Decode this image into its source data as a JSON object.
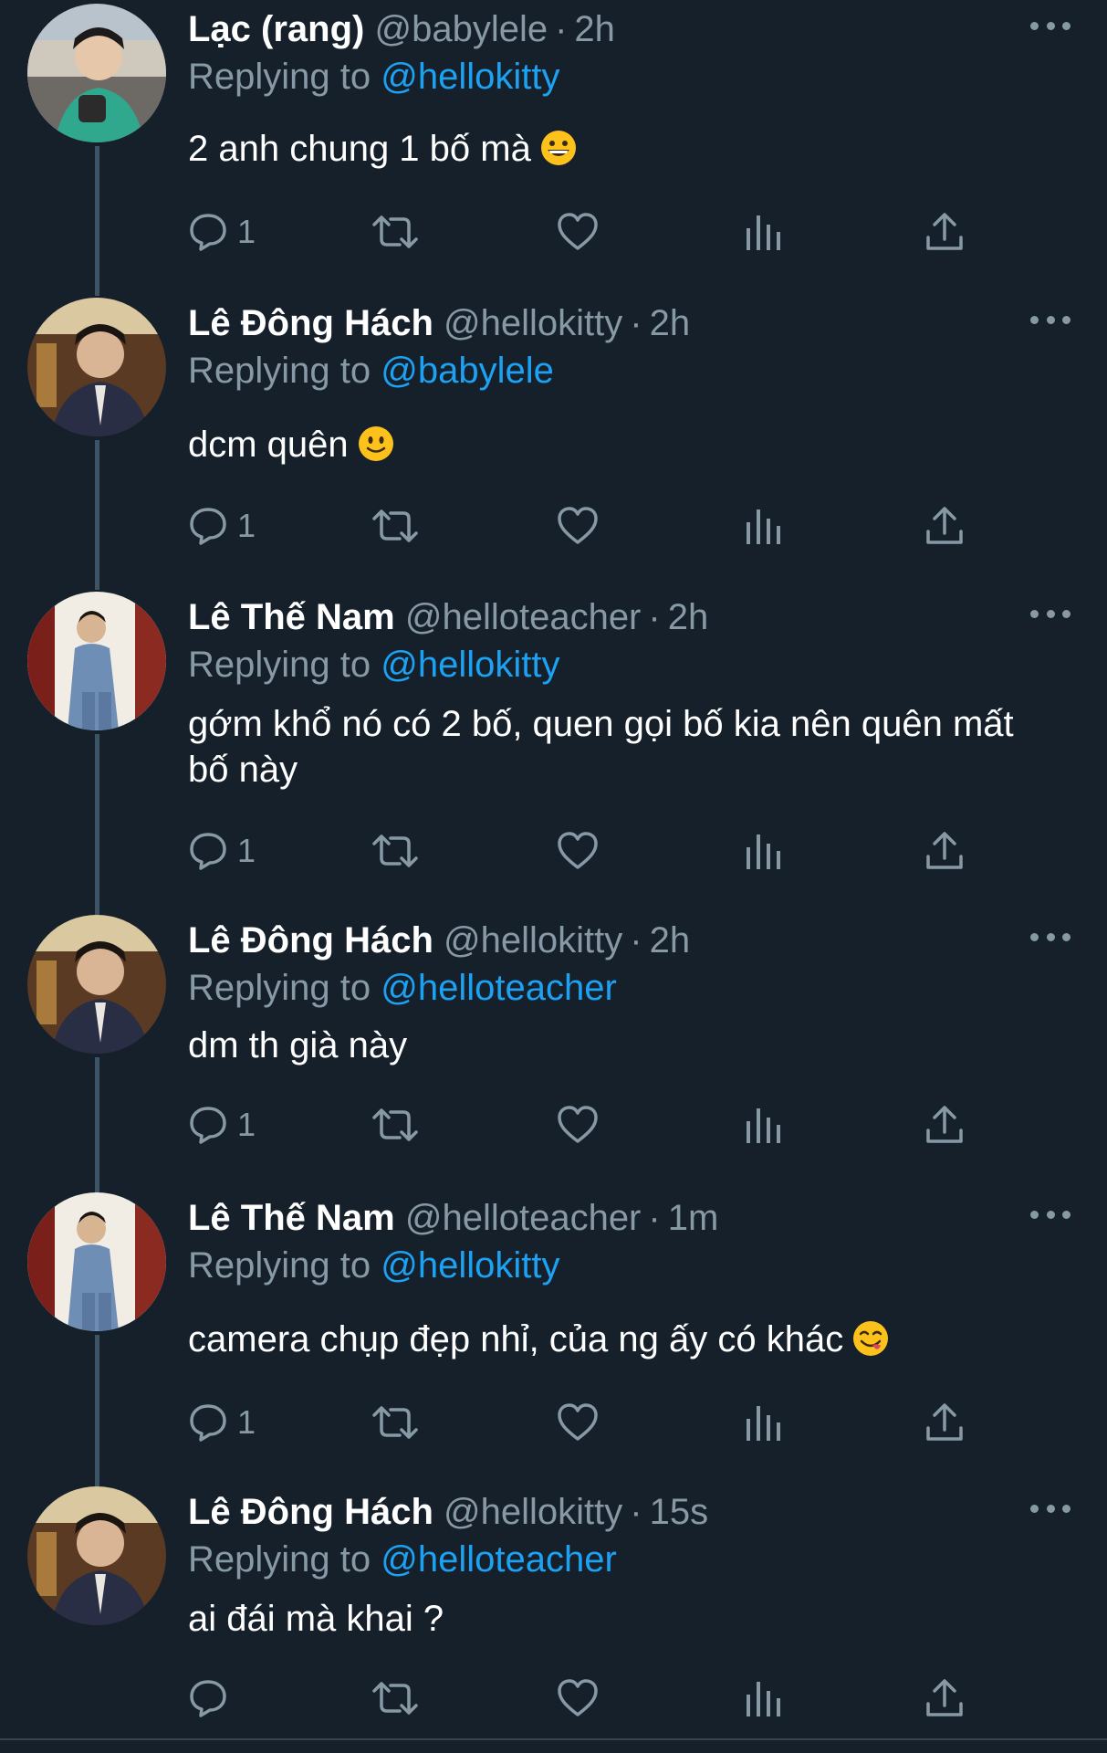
{
  "colors": {
    "background": "#15202b",
    "primary_text": "#ffffff",
    "secondary_text": "#8899a6",
    "mention": "#1da1f2",
    "thread_line": "#3d5466"
  },
  "replying_prefix": "Replying to",
  "tweets": [
    {
      "name": "Lạc (rang)",
      "handle": "@babylele",
      "time": "2h",
      "reply_to": "@hellokitty",
      "text": "2 anh chung 1 bố mà",
      "emoji": "grinning-face",
      "reply_count": "1",
      "avatar": "avatar-green-sweater"
    },
    {
      "name": "Lê Đông Hách",
      "handle": "@hellokitty",
      "time": "2h",
      "reply_to": "@babylele",
      "text": "dcm quên",
      "emoji": "slightly-smiling-face",
      "reply_count": "1",
      "avatar": "avatar-dark-jacket"
    },
    {
      "name": "Lê Thế Nam",
      "handle": "@helloteacher",
      "time": "2h",
      "reply_to": "@hellokitty",
      "text": "gớm khổ nó có 2 bố, quen gọi bố kia nên quên mất bố này",
      "emoji": "",
      "reply_count": "1",
      "avatar": "avatar-denim-jacket"
    },
    {
      "name": "Lê Đông Hách",
      "handle": "@hellokitty",
      "time": "2h",
      "reply_to": "@helloteacher",
      "text": "dm th già này",
      "emoji": "",
      "reply_count": "1",
      "avatar": "avatar-dark-jacket"
    },
    {
      "name": "Lê Thế Nam",
      "handle": "@helloteacher",
      "time": "1m",
      "reply_to": "@hellokitty",
      "text": "camera chụp đẹp nhỉ, của ng ấy có khác",
      "emoji": "face-savoring-food",
      "reply_count": "1",
      "avatar": "avatar-denim-jacket"
    },
    {
      "name": "Lê Đông Hách",
      "handle": "@hellokitty",
      "time": "15s",
      "reply_to": "@helloteacher",
      "text": "ai đái mà khai ?",
      "emoji": "",
      "reply_count": "",
      "avatar": "avatar-dark-jacket"
    }
  ]
}
